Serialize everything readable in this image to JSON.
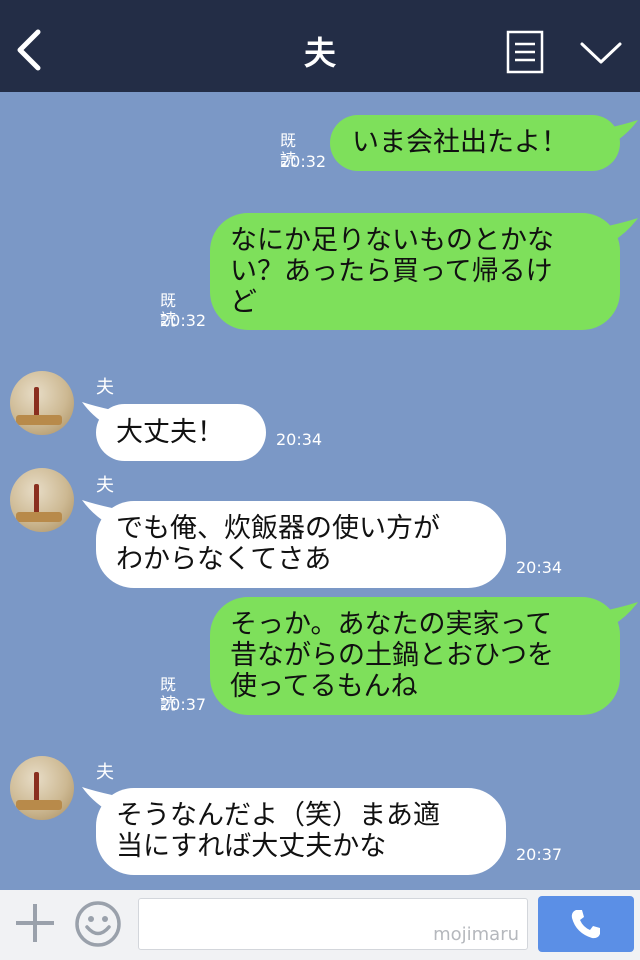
{
  "header": {
    "title": "夫"
  },
  "messages": [
    {
      "from": "me",
      "text": "いま会社出たよ！",
      "read": "既読",
      "time": "20:32"
    },
    {
      "from": "me",
      "text": "なにか足りないものとかな\nい？あったら買って帰るけ\nど",
      "read": "既読",
      "time": "20:32"
    },
    {
      "from": "them",
      "sender": "夫",
      "text": "大丈夫！",
      "time": "20:34"
    },
    {
      "from": "them",
      "sender": "夫",
      "text": "でも俺、炊飯器の使い方が\nわからなくてさあ",
      "time": "20:34"
    },
    {
      "from": "me",
      "text": "そっか。あなたの実家って\n昔ながらの土鍋とおひつを\n使ってるもんね",
      "read": "既読",
      "time": "20:37"
    },
    {
      "from": "them",
      "sender": "夫",
      "text": "そうなんだよ（笑）まあ適\n当にすれば大丈夫かな",
      "time": "20:37"
    }
  ],
  "input": {
    "watermark": "mojimaru"
  },
  "colors": {
    "header": "#232d46",
    "background": "#7b98c6",
    "my_bubble": "#7ee05b",
    "their_bubble": "#ffffff",
    "call_button": "#5b8fe6"
  },
  "icons": [
    "back-icon",
    "menu-icon",
    "chevron-down-icon",
    "plus-icon",
    "emoji-icon",
    "phone-icon"
  ]
}
